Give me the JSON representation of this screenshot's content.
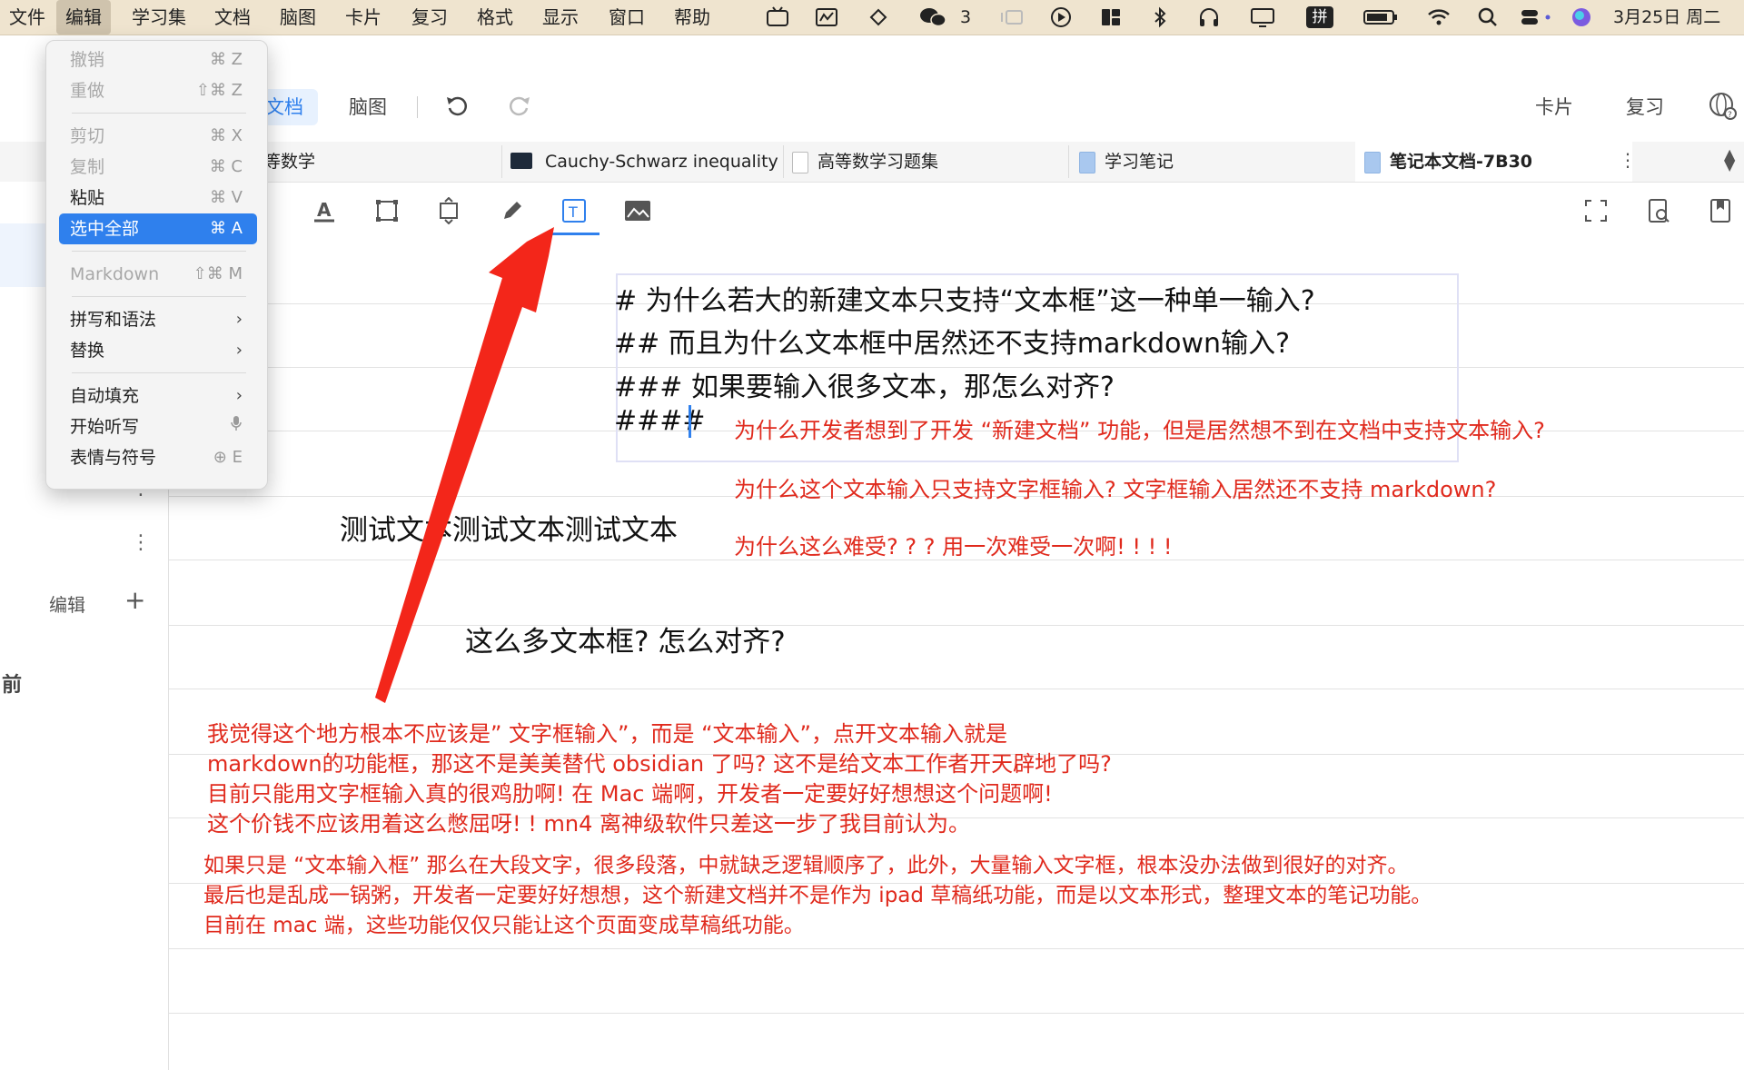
{
  "menubar": {
    "items": [
      "文件",
      "编辑",
      "学习集",
      "文档",
      "脑图",
      "卡片",
      "复习",
      "格式",
      "显示",
      "窗口",
      "帮助"
    ],
    "wechat_count": "3",
    "input_method": "拼",
    "datetime": "3月25日 周二"
  },
  "edit_menu": {
    "undo": "撤销",
    "undo_sc": "⌘ Z",
    "redo": "重做",
    "redo_sc": "⇧⌘ Z",
    "cut": "剪切",
    "cut_sc": "⌘ X",
    "copy": "复制",
    "copy_sc": "⌘ C",
    "paste": "粘贴",
    "paste_sc": "⌘ V",
    "select_all": "选中全部",
    "select_all_sc": "⌘ A",
    "markdown": "Markdown",
    "markdown_sc": "⇧⌘ M",
    "spelling": "拼写和语法",
    "substitutions": "替换",
    "autofill": "自动填充",
    "dictation": "开始听写",
    "emoji": "表情与符号",
    "emoji_sc": "E"
  },
  "topbar": {
    "mode_doc": "文档",
    "mode_mindmap": "脑图",
    "cards": "卡片",
    "review": "复习"
  },
  "tabs": [
    {
      "label": "等数学"
    },
    {
      "label": "Cauchy-Schwarz inequality"
    },
    {
      "label": "高等数学习题集"
    },
    {
      "label": "学习笔记"
    },
    {
      "label": "笔记本文档-7B30"
    }
  ],
  "sidebar": {
    "edit_label": "编辑",
    "partial_label": "前"
  },
  "document": {
    "textbox_lines": [
      "# 为什么若大的新建文本只支持“文本框”这一种单一输入?",
      "## 而且为什么文本框中居然还不支持markdown输入?",
      "### 如果要输入很多文本，那怎么对齐?",
      "####"
    ],
    "red_notes_top": [
      "为什么开发者想到了开发 “新建文档” 功能，但是居然想不到在文档中支持文本输入?",
      "为什么这个文本输入只支持文字框输入?   文字框输入居然还不支持 markdown?",
      "为什么这么难受? ? ?  用一次难受一次啊! ! ! !"
    ],
    "test_text": "测试文本测试文本测试文本",
    "align_question": "这么多文本框? 怎么对齐?",
    "red_paragraph_1": [
      "我觉得这个地方根本不应该是” 文字框输入”，而是 “文本输入”，点开文本输入就是",
      "markdown的功能框，那这不是美美替代 obsidian 了吗? 这不是给文本工作者开天辟地了吗?",
      "目前只能用文字框输入真的很鸡肋啊!  在 Mac 端啊，开发者一定要好好想想这个问题啊!",
      "这个价钱不应该用着这么憋屈呀! !  mn4 离神级软件只差这一步了我目前认为。"
    ],
    "red_paragraph_2": [
      "如果只是 “文本输入框” 那么在大段文字，很多段落，中就缺乏逻辑顺序了，此外，大量输入文字框，根本没办法做到很好的对齐。",
      "最后也是乱成一锅粥，开发者一定要好好想想，这个新建文档并不是作为 ipad 草稿纸功能，而是以文本形式，整理文本的笔记功能。",
      "目前在 mac 端，这些功能仅仅只能让这个页面变成草稿纸功能。"
    ]
  },
  "colors": {
    "accent": "#2f80ed",
    "annotation_red": "#e02a1d",
    "menubar_bg": "#efe4cf"
  }
}
